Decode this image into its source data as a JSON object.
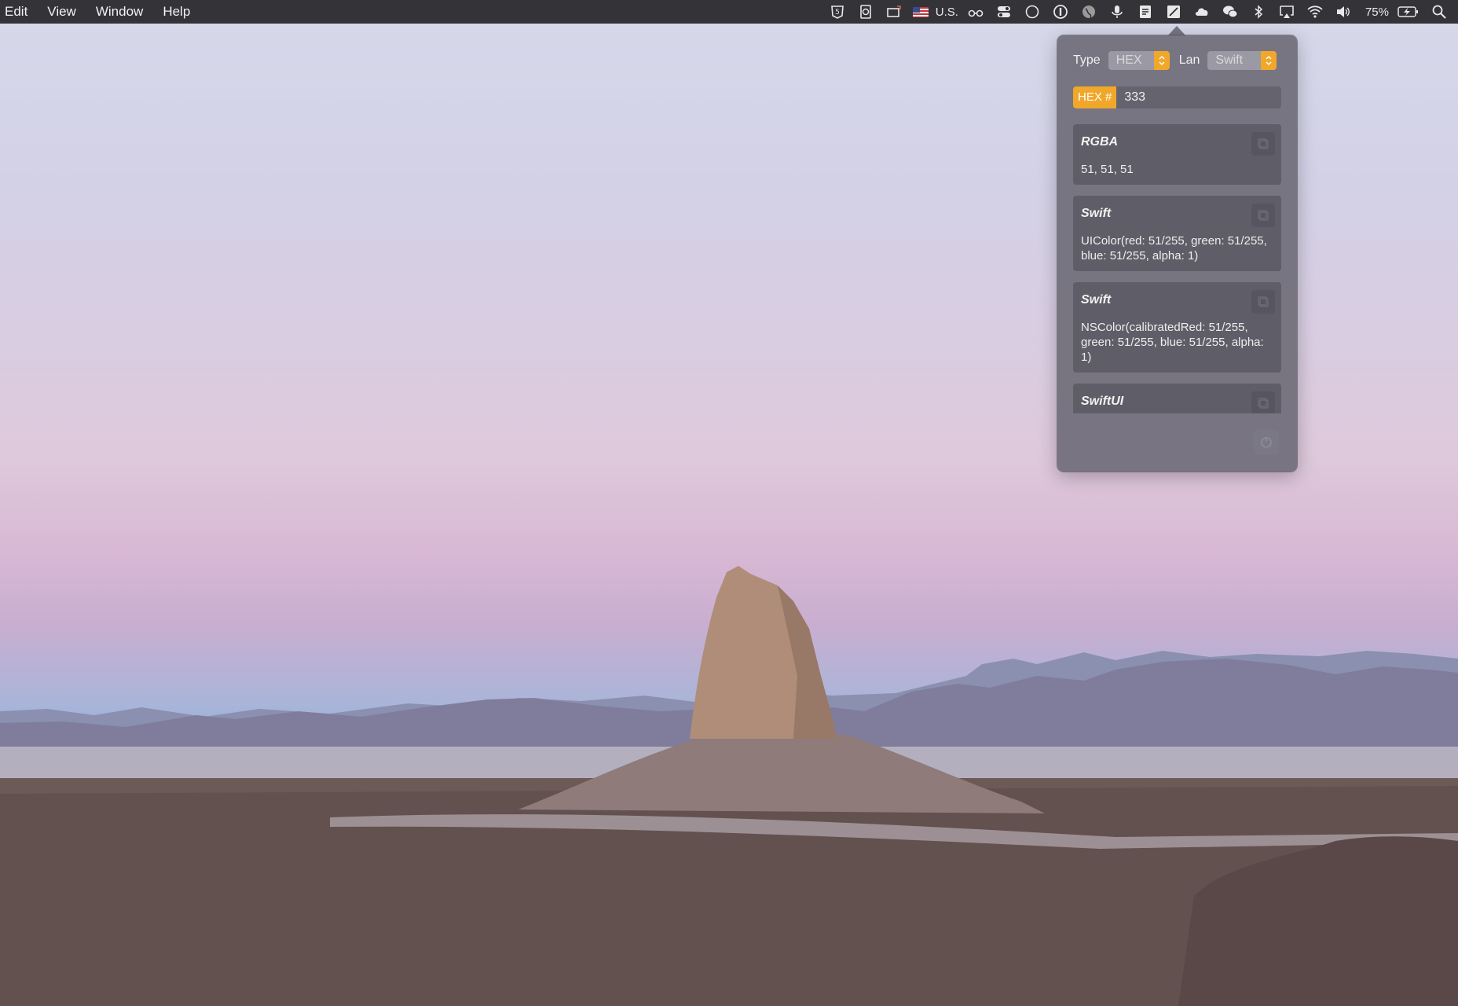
{
  "menubar": {
    "menus": [
      "Edit",
      "View",
      "Window",
      "Help"
    ],
    "input_source": "U.S.",
    "battery_percent": "75%"
  },
  "popover": {
    "type_label": "Type",
    "type_value": "HEX",
    "lan_label": "Lan",
    "lan_value": "Swift",
    "hex_prefix": "HEX #",
    "hex_value": "333",
    "cards": [
      {
        "title": "RGBA",
        "value": "51, 51, 51"
      },
      {
        "title": "Swift",
        "value": "UIColor(red: 51/255, green: 51/255, blue: 51/255, alpha: 1)"
      },
      {
        "title": "Swift",
        "value": "NSColor(calibratedRed: 51/255, green: 51/255, blue: 51/255, alpha: 1)"
      },
      {
        "title": "SwiftUI",
        "value": ""
      }
    ]
  },
  "colors": {
    "accent": "#f0a72a",
    "popover_bg": "#706e7a",
    "card_bg": "#5f5d67",
    "menubar_bg": "#2c2c30"
  }
}
